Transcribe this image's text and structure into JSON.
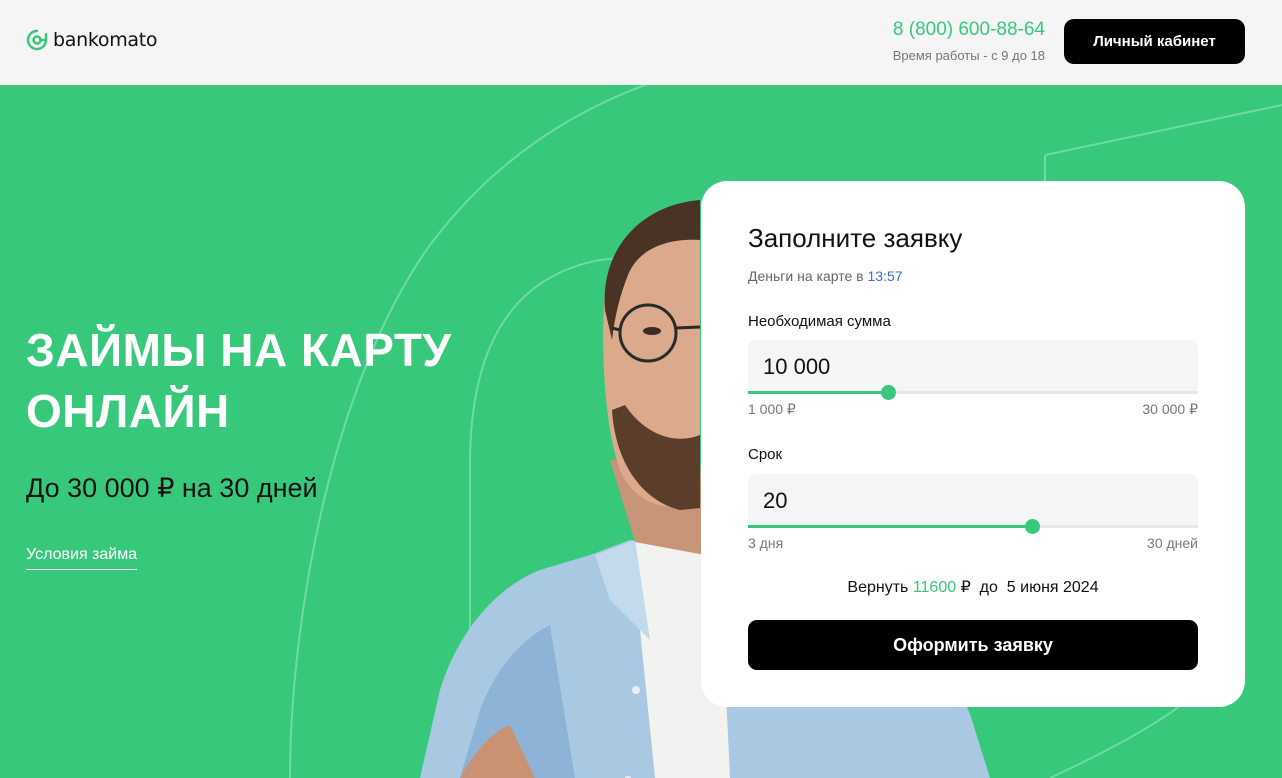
{
  "header": {
    "logo_text": "bankomato",
    "phone": "8 (800) 600-88-64",
    "hours": "Время работы - с 9 до 18",
    "cabinet_label": "Личный кабинет"
  },
  "hero": {
    "title_line1": "ЗАЙМЫ НА КАРТУ",
    "title_line2": "ОНЛАЙН",
    "subtitle": "До 30 000 ₽ на 30 дней",
    "terms_link": "Условия займа"
  },
  "form": {
    "title": "Заполните заявку",
    "eta_prefix": "Деньги на карте в",
    "eta_time": "13:57",
    "amount": {
      "label": "Необходимая сумма",
      "value": "10 000",
      "min_label": "1 000 ₽",
      "max_label": "30 000 ₽",
      "fraction": 0.31
    },
    "term": {
      "label": "Срок",
      "value": "20",
      "min_label": "3 дня",
      "max_label": "30 дней",
      "fraction": 0.63
    },
    "return": {
      "prefix": "Вернуть",
      "amount": "11600",
      "currency": "₽",
      "until": "до",
      "date": "5 июня 2024"
    },
    "submit_label": "Оформить заявку"
  },
  "colors": {
    "brand_green": "#37c87c",
    "dark": "#000000",
    "link_blue": "#3a6fc9"
  }
}
